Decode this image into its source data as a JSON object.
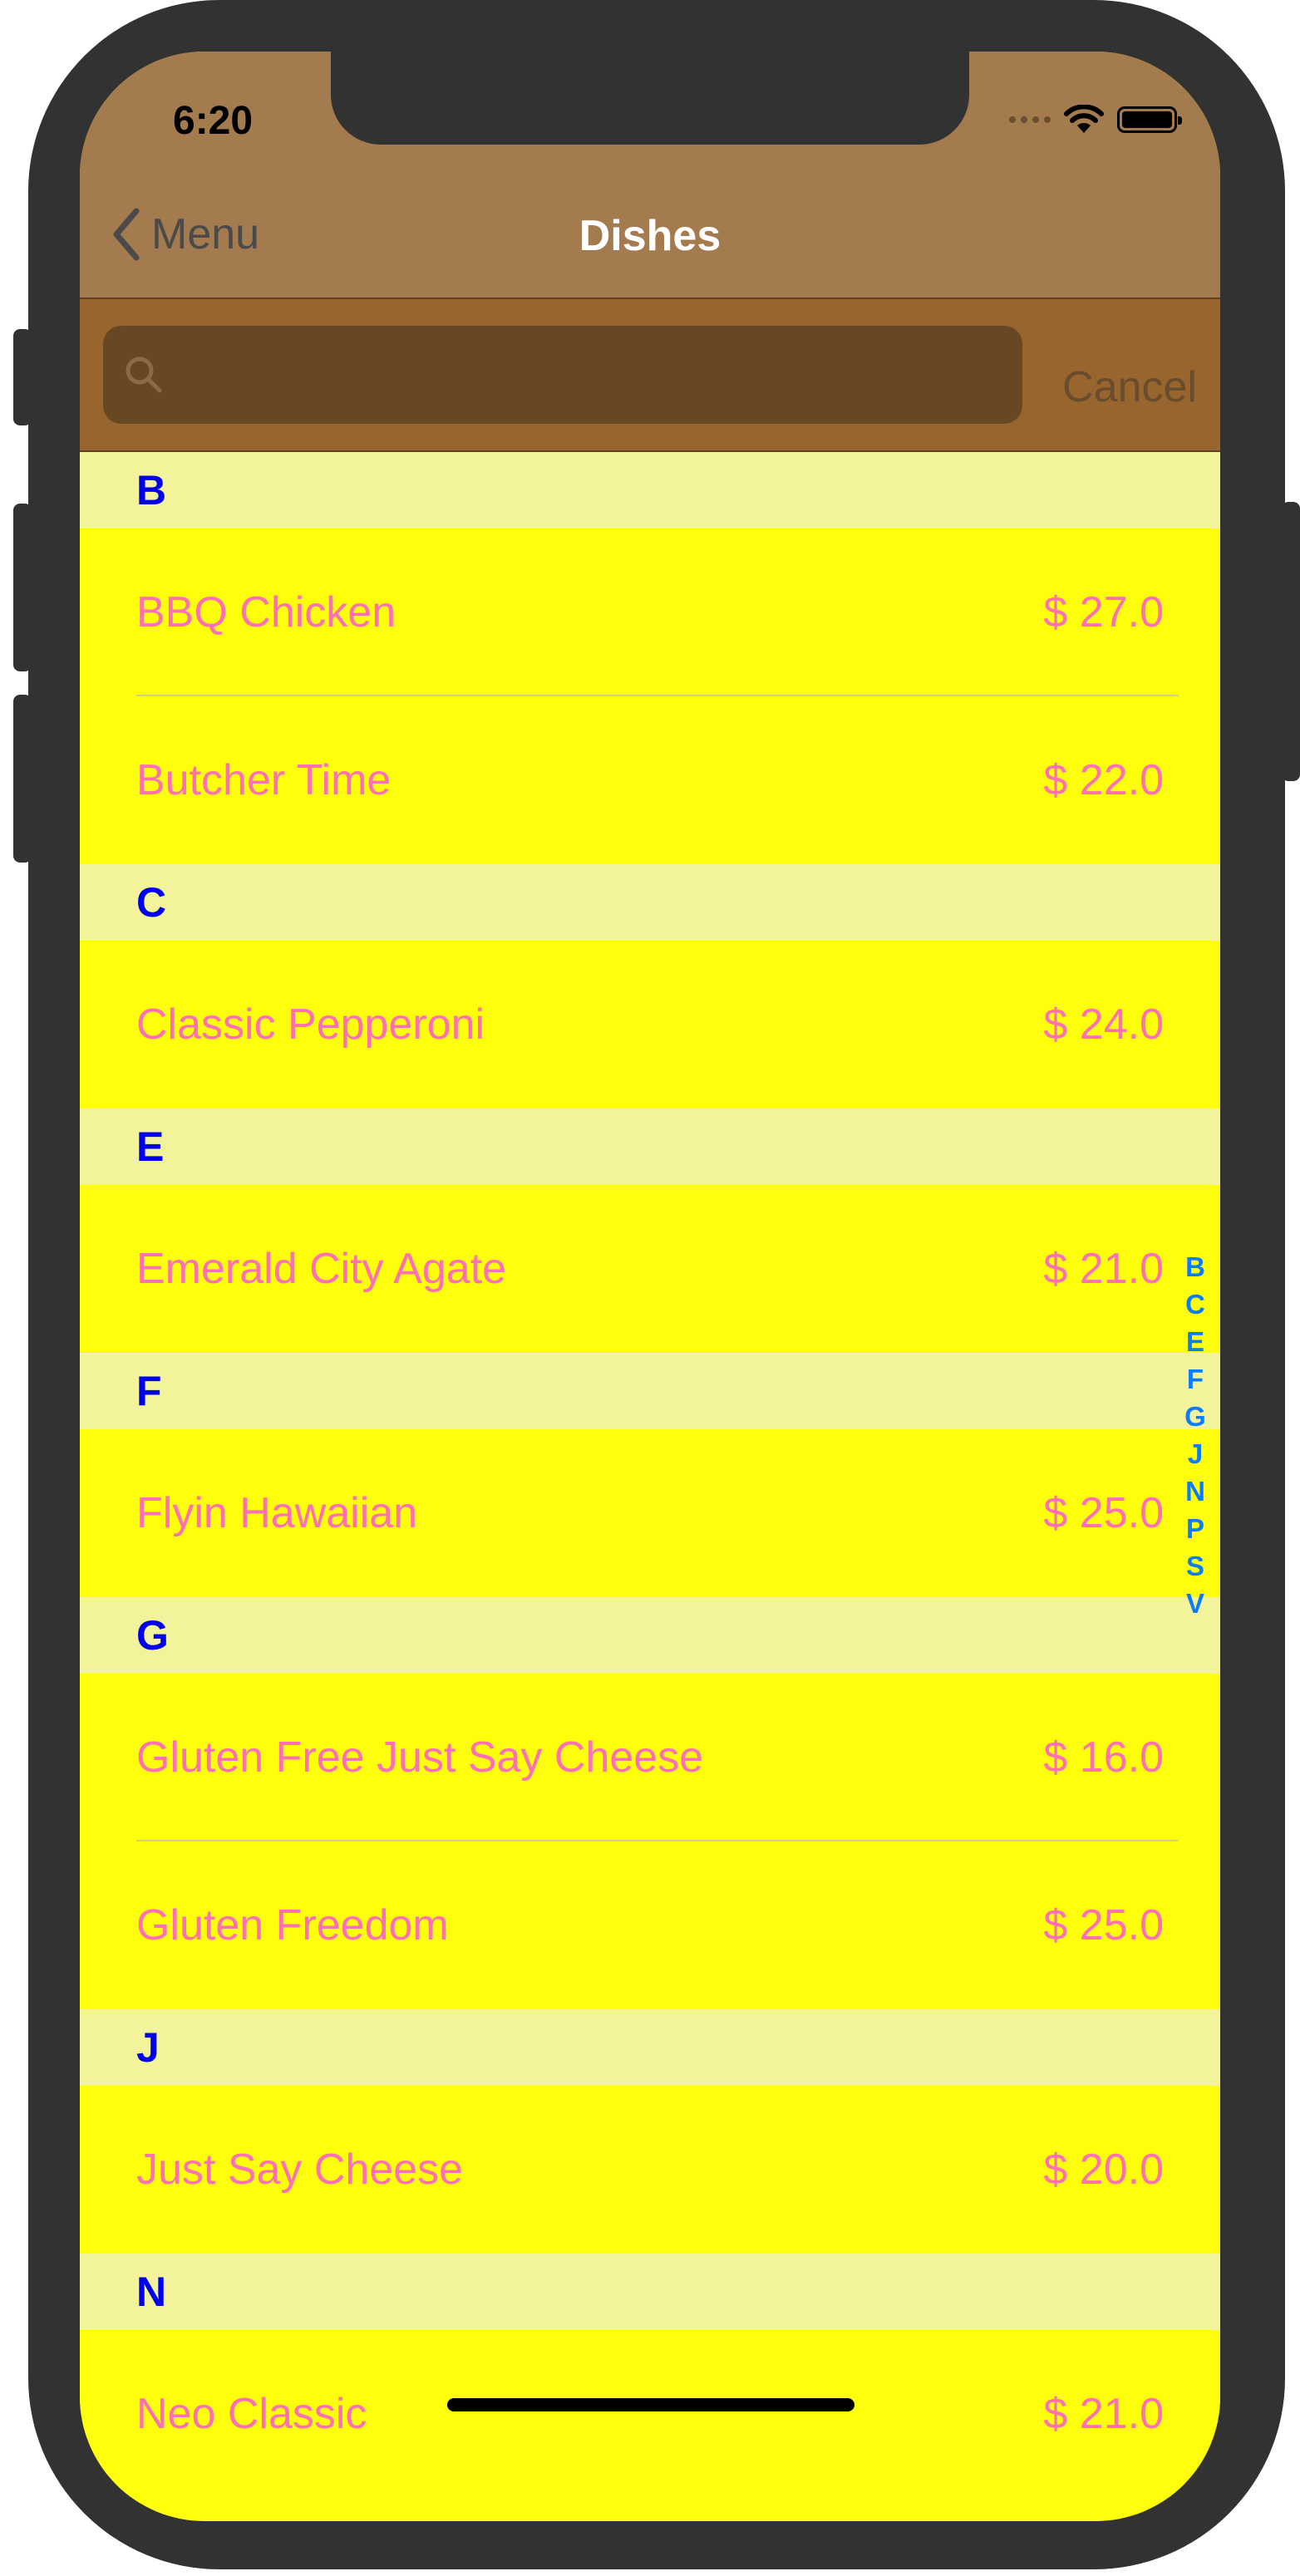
{
  "status": {
    "time": "6:20"
  },
  "nav": {
    "back_label": "Menu",
    "title": "Dishes"
  },
  "search": {
    "placeholder": "",
    "value": "",
    "cancel_label": "Cancel"
  },
  "sections": [
    {
      "letter": "B",
      "dishes": [
        {
          "name": "BBQ Chicken",
          "price": "$ 27.0"
        },
        {
          "name": "Butcher Time",
          "price": "$ 22.0"
        }
      ]
    },
    {
      "letter": "C",
      "dishes": [
        {
          "name": "Classic Pepperoni",
          "price": "$ 24.0"
        }
      ]
    },
    {
      "letter": "E",
      "dishes": [
        {
          "name": "Emerald City Agate",
          "price": "$ 21.0"
        }
      ]
    },
    {
      "letter": "F",
      "dishes": [
        {
          "name": "Flyin Hawaiian",
          "price": "$ 25.0"
        }
      ]
    },
    {
      "letter": "G",
      "dishes": [
        {
          "name": "Gluten Free Just Say Cheese",
          "price": "$ 16.0"
        },
        {
          "name": "Gluten Freedom",
          "price": "$ 25.0"
        }
      ]
    },
    {
      "letter": "J",
      "dishes": [
        {
          "name": "Just Say Cheese",
          "price": "$ 20.0"
        }
      ]
    },
    {
      "letter": "N",
      "dishes": [
        {
          "name": "Neo Classic",
          "price": "$ 21.0"
        }
      ]
    }
  ],
  "index": [
    "B",
    "C",
    "E",
    "F",
    "G",
    "J",
    "N",
    "P",
    "S",
    "V"
  ],
  "colors": {
    "nav_bg": "#a47a4f",
    "search_bg": "#99652e",
    "row_bg": "#ffff0b",
    "header_bg": "#f3f39b",
    "header_text": "#0000ee",
    "dish_text": "#ff6fb5",
    "index_text": "#0a7cff"
  },
  "icons": [
    "chevron-left-icon",
    "search-icon",
    "wifi-icon",
    "battery-icon",
    "cellular-icon"
  ]
}
